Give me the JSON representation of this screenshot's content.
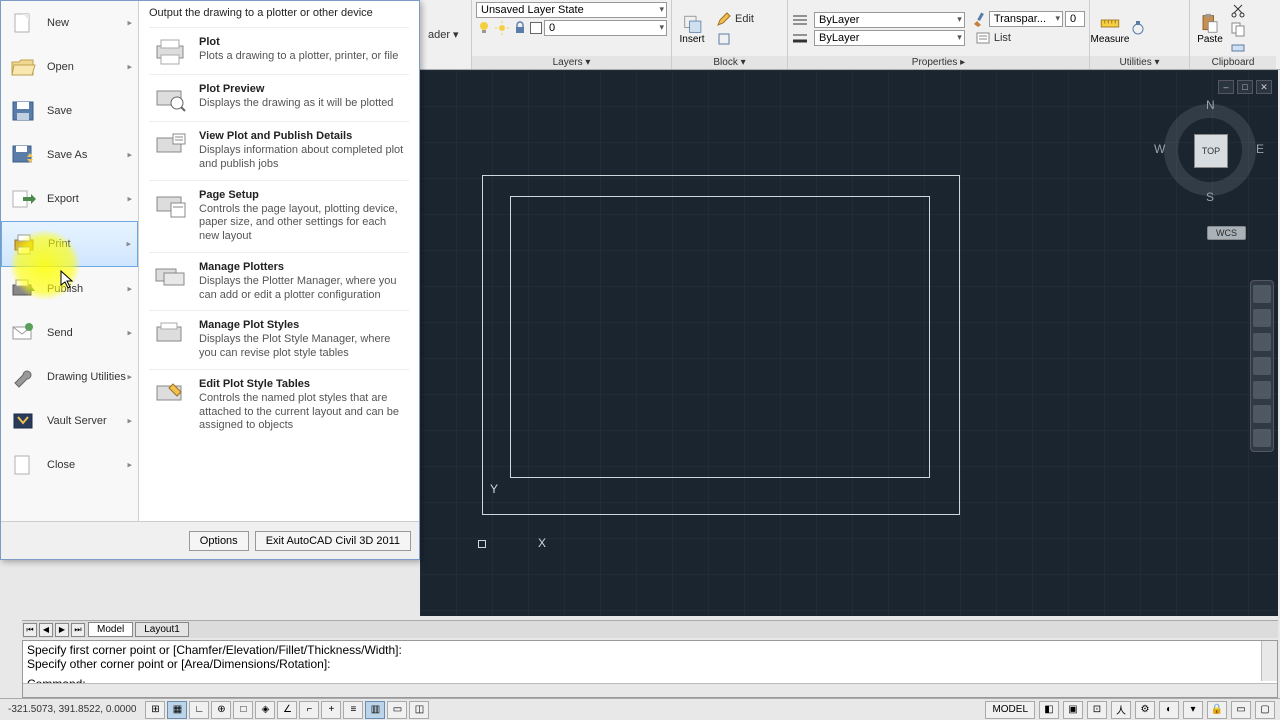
{
  "ribbon": {
    "leader_label": "ader",
    "layer_state": "Unsaved Layer State",
    "layer_value": "0",
    "insert": "Insert",
    "edit": "Edit",
    "list": "List",
    "bylayer": "ByLayer",
    "transpar": "Transpar...",
    "transpar_val": "0",
    "measure": "Measure",
    "paste": "Paste",
    "groups": {
      "layers": "Layers",
      "block": "Block",
      "properties": "Properties",
      "utilities": "Utilities",
      "clipboard": "Clipboard"
    }
  },
  "menu": {
    "header": "Output the drawing to a plotter or other device",
    "left": [
      {
        "label": "New"
      },
      {
        "label": "Open"
      },
      {
        "label": "Save"
      },
      {
        "label": "Save As"
      },
      {
        "label": "Export"
      },
      {
        "label": "Print"
      },
      {
        "label": "Publish"
      },
      {
        "label": "Send"
      },
      {
        "label": "Drawing Utilities"
      },
      {
        "label": "Vault Server"
      },
      {
        "label": "Close"
      }
    ],
    "sub": [
      {
        "title": "Plot",
        "desc": "Plots a drawing to a plotter, printer, or file"
      },
      {
        "title": "Plot Preview",
        "desc": "Displays the drawing as it will be plotted"
      },
      {
        "title": "View Plot and Publish Details",
        "desc": "Displays information about completed plot and publish jobs"
      },
      {
        "title": "Page Setup",
        "desc": "Controls the page layout, plotting device, paper size, and other settings for each new layout"
      },
      {
        "title": "Manage Plotters",
        "desc": "Displays the Plotter Manager, where you can add or edit a plotter configuration"
      },
      {
        "title": "Manage Plot Styles",
        "desc": "Displays the Plot Style Manager, where you can revise plot style tables"
      },
      {
        "title": "Edit Plot Style Tables",
        "desc": "Controls the named plot styles that are attached to the current layout and can be assigned to objects"
      }
    ],
    "options": "Options",
    "exit": "Exit AutoCAD Civil 3D 2011"
  },
  "viewcube": {
    "top": "TOP",
    "n": "N",
    "s": "S",
    "e": "E",
    "w": "W",
    "wcs": "WCS"
  },
  "tabs": {
    "model": "Model",
    "layout1": "Layout1"
  },
  "cmd": {
    "l1": "Specify first corner point or [Chamfer/Elevation/Fillet/Thickness/Width]:",
    "l2": "Specify other corner point or [Area/Dimensions/Rotation]:",
    "prompt": "Command:"
  },
  "status": {
    "coords": "-321.5073, 391.8522, 0.0000",
    "model": "MODEL"
  },
  "origin": {
    "y": "Y",
    "x": "X"
  }
}
